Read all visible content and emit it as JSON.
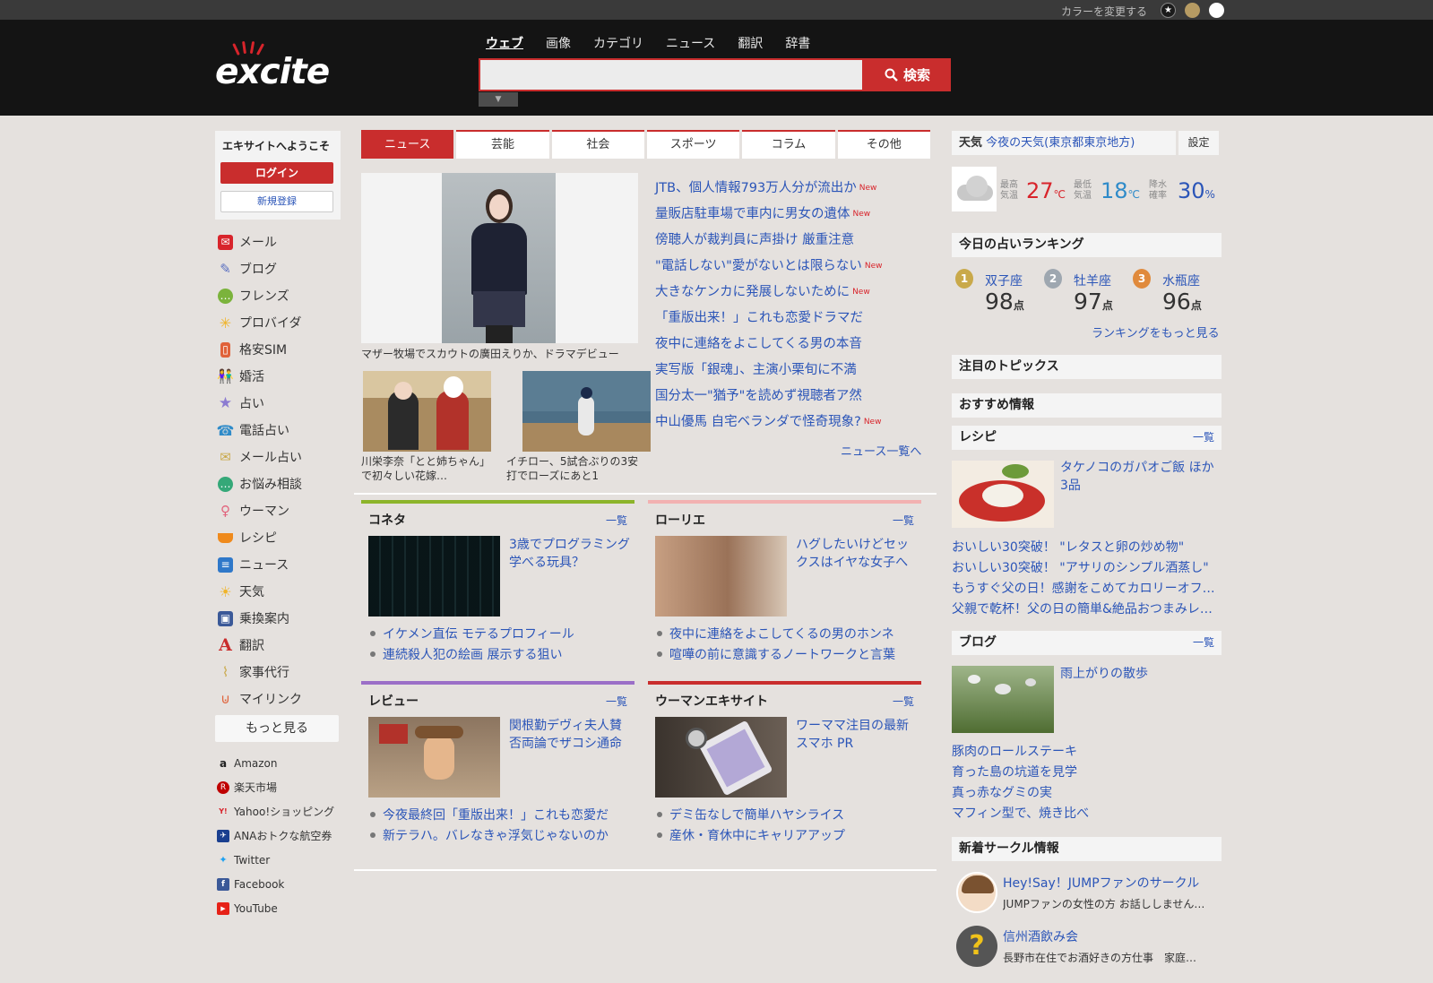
{
  "topbar": {
    "color_label": "カラーを変更する",
    "colors": [
      "#1b1b1b",
      "#b69b63",
      "#ffffff"
    ]
  },
  "header": {
    "logo": "excite",
    "search_tabs": [
      "ウェブ",
      "画像",
      "カテゴリ",
      "ニュース",
      "翻訳",
      "辞書"
    ],
    "search_placeholder": "",
    "search_button": "検索",
    "search_dropdown": "▼"
  },
  "left": {
    "welcome": "エキサイトへようこそ",
    "login": "ログイン",
    "register": "新規登録",
    "services": [
      {
        "label": "メール",
        "icon": "mail-icon",
        "color": "#d8242b"
      },
      {
        "label": "ブログ",
        "icon": "pencil-icon",
        "color": "#5a6fc0"
      },
      {
        "label": "フレンズ",
        "icon": "chat-icon",
        "color": "#7bb33c"
      },
      {
        "label": "プロバイダ",
        "icon": "sun-icon",
        "color": "#f0b429"
      },
      {
        "label": "格安SIM",
        "icon": "phone-icon",
        "color": "#e0623a"
      },
      {
        "label": "婚活",
        "icon": "couple-icon",
        "color": "#ef8a3c"
      },
      {
        "label": "占い",
        "icon": "star-icon",
        "color": "#8c7bd1"
      },
      {
        "label": "電話占い",
        "icon": "receiver-icon",
        "color": "#2f8bc9"
      },
      {
        "label": "メール占い",
        "icon": "envelope-star-icon",
        "color": "#c9a94a"
      },
      {
        "label": "お悩み相談",
        "icon": "bubble-icon",
        "color": "#35a878"
      },
      {
        "label": "ウーマン",
        "icon": "woman-icon",
        "color": "#e2637c"
      },
      {
        "label": "レシピ",
        "icon": "pot-icon",
        "color": "#ef8a1c"
      },
      {
        "label": "ニュース",
        "icon": "news-icon",
        "color": "#2f78c9"
      },
      {
        "label": "天気",
        "icon": "weather-icon",
        "color": "#f0b429"
      },
      {
        "label": "乗換案内",
        "icon": "train-icon",
        "color": "#3b5998"
      },
      {
        "label": "翻訳",
        "icon": "translate-icon",
        "color": "#c92d2d"
      },
      {
        "label": "家事代行",
        "icon": "broom-icon",
        "color": "#c9a94a"
      },
      {
        "label": "マイリンク",
        "icon": "clip-icon",
        "color": "#e0623a"
      }
    ],
    "more": "もっと見る",
    "external": [
      {
        "label": "Amazon",
        "icon": "amazon-icon",
        "color": "#222222",
        "glyph": "a"
      },
      {
        "label": "楽天市場",
        "icon": "rakuten-icon",
        "color": "#bf0000",
        "glyph": "R"
      },
      {
        "label": "Yahoo!ショッピング",
        "icon": "yahoo-icon",
        "color": "#d8242b",
        "glyph": "Y!"
      },
      {
        "label": "ANAおトクな航空券",
        "icon": "ana-icon",
        "color": "#1a3f8f",
        "glyph": "✈"
      },
      {
        "label": "Twitter",
        "icon": "twitter-icon",
        "color": "#1da1f2",
        "glyph": "🐦"
      },
      {
        "label": "Facebook",
        "icon": "facebook-icon",
        "color": "#3b5998",
        "glyph": "f"
      },
      {
        "label": "YouTube",
        "icon": "youtube-icon",
        "color": "#e62117",
        "glyph": "▶"
      }
    ]
  },
  "news": {
    "tabs": [
      "ニュース",
      "芸能",
      "社会",
      "スポーツ",
      "コラム",
      "その他"
    ],
    "main_caption": "マザー牧場でスカウトの廣田えりか、ドラマデビュー",
    "thumbs": [
      "川栄李奈「とと姉ちゃん」で初々しい花嫁…",
      "イチロー、5試合ぶりの3安打でローズにあと1"
    ],
    "headlines": [
      {
        "text": "JTB、個人情報793万人分が流出か",
        "new": "New"
      },
      {
        "text": "量販店駐車場で車内に男女の遺体",
        "new": "New"
      },
      {
        "text": "傍聴人が裁判員に声掛け 厳重注意",
        "new": ""
      },
      {
        "text": "\"電話しない\"愛がないとは限らない",
        "new": "New"
      },
      {
        "text": "大きなケンカに発展しないために",
        "new": "New"
      },
      {
        "text": "「重版出来！」これも恋愛ドラマだ",
        "new": ""
      },
      {
        "text": "夜中に連絡をよこしてくる男の本音",
        "new": ""
      },
      {
        "text": "実写版「銀魂」、主演小栗旬に不満",
        "new": ""
      },
      {
        "text": "国分太一\"猶予\"を読めず視聴者ア然",
        "new": ""
      },
      {
        "text": "中山優馬 自宅ベランダで怪奇現象?",
        "new": "New"
      }
    ],
    "more": "ニュース一覧へ"
  },
  "boxes": [
    {
      "title": "コネタ",
      "link": "一覧",
      "color": "#8cb42a",
      "desc": "3歳でプログラミング学べる玩具？",
      "items": [
        "イケメン直伝 モテるプロフィール",
        "連続殺人犯の絵画 展示する狙い"
      ]
    },
    {
      "title": "ローリエ",
      "link": "一覧",
      "color": "#f2b1b1",
      "desc": "ハグしたいけどセックスはイヤな女子へ",
      "items": [
        "夜中に連絡をよこしてくるの男のホンネ",
        "喧嘩の前に意識するノートワークと言葉"
      ]
    },
    {
      "title": "レビュー",
      "link": "一覧",
      "color": "#9b6fc7",
      "desc": "関根勤デヴィ夫人賛否両論でザコシ通命",
      "items": [
        "今夜最終回「重版出来！」これも恋愛だ",
        "新テラハ。バレなきゃ浮気じゃないのか"
      ]
    },
    {
      "title": "ウーマンエキサイト",
      "link": "一覧",
      "color": "#c92d2d",
      "desc": "ワーママ注目の最新スマホ PR",
      "items": [
        "デミ缶なしで簡単ハヤシライス",
        "産休・育休中にキャリアアップ"
      ]
    }
  ],
  "weather": {
    "label": "天気",
    "location": "今夜の天気(東京都東京地方)",
    "settings": "設定",
    "max_label": "最高気温",
    "max": "27",
    "max_unit": "℃",
    "min_label": "最低気温",
    "min": "18",
    "min_unit": "℃",
    "rain_label": "降水確率",
    "rain": "30",
    "rain_unit": "%"
  },
  "fortune": {
    "title": "今日の占いランキング",
    "ranks": [
      {
        "rank": "1",
        "sign": "双子座",
        "score": "98",
        "unit": "点",
        "color": "#c9a94a"
      },
      {
        "rank": "2",
        "sign": "牡羊座",
        "score": "97",
        "unit": "点",
        "color": "#9ea7b0"
      },
      {
        "rank": "3",
        "sign": "水瓶座",
        "score": "96",
        "unit": "点",
        "color": "#e08a3c"
      }
    ],
    "more": "ランキングをもっと見る"
  },
  "topics": {
    "title": "注目のトピックス"
  },
  "recommend": {
    "title": "おすすめ情報"
  },
  "recipe": {
    "title": "レシピ",
    "link": "一覧",
    "desc": "タケノコのガパオご飯 ほか3品",
    "items": [
      "おいしい30突破！ \"レタスと卵の炒め物\"",
      "おいしい30突破！ \"アサリのシンプル酒蒸し\"",
      "もうすぐ父の日！感謝をこめてカロリーオフ…",
      "父親で乾杯！父の日の簡単&絶品おつまみレ…"
    ]
  },
  "blog": {
    "title": "ブログ",
    "link": "一覧",
    "desc": "雨上がりの散歩",
    "items": [
      "豚肉のロールステーキ",
      "育った島の坑道を見学",
      "真っ赤なグミの実",
      "マフィン型で、焼き比べ"
    ]
  },
  "circle": {
    "title": "新着サークル情報",
    "items": [
      {
        "name": "Hey!Say！JUMPファンのサークル",
        "desc": "JUMPファンの女性の方 お話ししません…",
        "avatar": "#e8c9a8"
      },
      {
        "name": "信州酒飲み会",
        "desc": "長野市在住でお酒好きの方仕事　家庭…",
        "avatar": "#555555"
      }
    ]
  }
}
